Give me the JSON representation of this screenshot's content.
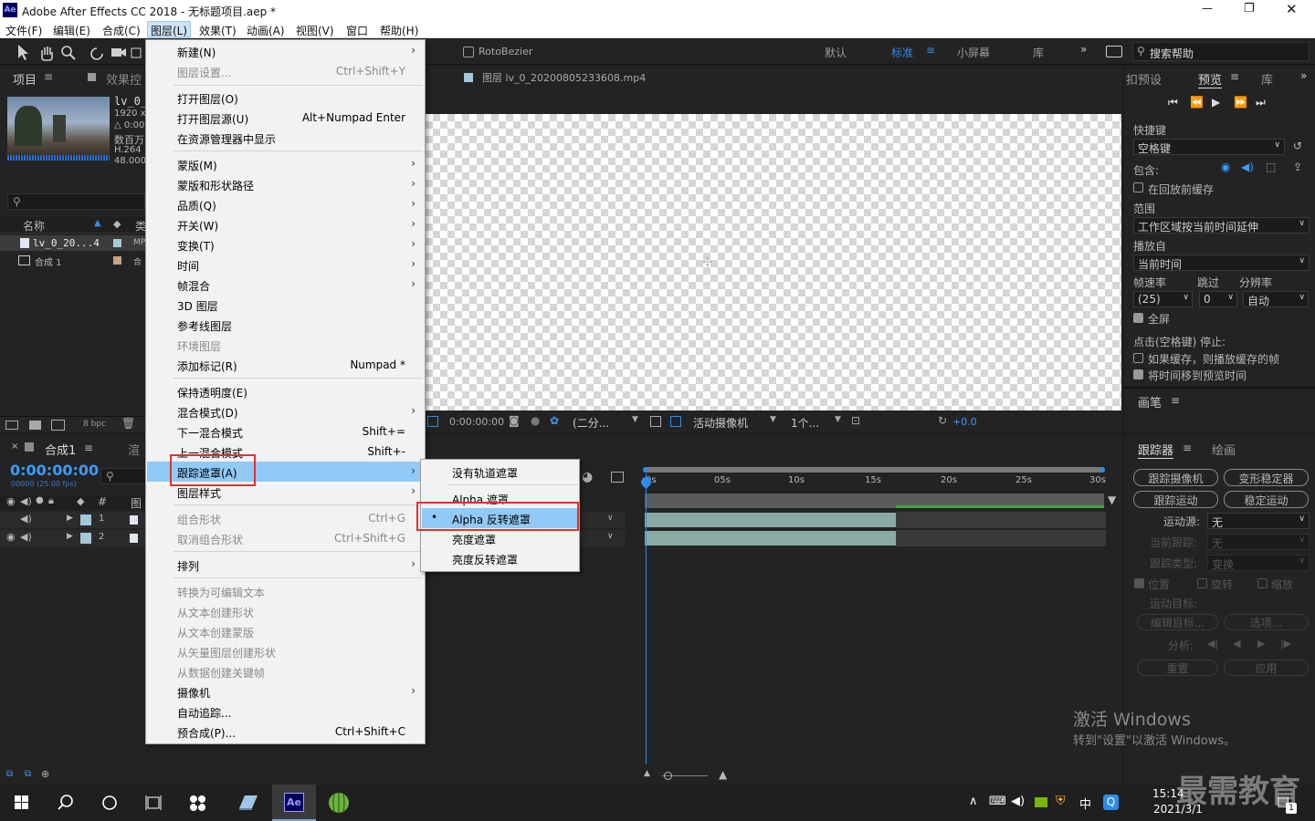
{
  "titlebar": {
    "title": "Adobe After Effects CC 2018 - 无标题项目.aep *",
    "logo": "Ae",
    "min": "—",
    "max": "❐",
    "close": "✕"
  },
  "menubar": [
    "文件(F)",
    "编辑(E)",
    "合成(C)",
    "图层(L)",
    "效果(T)",
    "动画(A)",
    "视图(V)",
    "窗口",
    "帮助(H)"
  ],
  "toolbar": {
    "rotobezier": "RotoBezier",
    "workspaces": [
      "默认",
      "标准",
      "小屏幕",
      "库"
    ],
    "search": "搜索帮助"
  },
  "project": {
    "tab1": "项目",
    "tab2": "效果控",
    "file_name": "lv_0_",
    "file_info": [
      "1920 x 1",
      "△ 0:00:",
      "数百万",
      "H.264",
      "48.000"
    ],
    "col_name": "名称",
    "col_type": "类",
    "rows": [
      {
        "name": "lv_0_20...4",
        "type": "MP"
      },
      {
        "name": "合成 1",
        "type": "合"
      }
    ],
    "bpc": "8 bpc"
  },
  "viewer": {
    "tab": "图层 lv_0_20200805233608.mp4",
    "timecode": "0:00:00:00",
    "res": "(二分...",
    "camera": "活动摄像机",
    "views": "1个...",
    "exposure": "+0.0"
  },
  "preview": {
    "tab1": "扣预设",
    "tab2": "预览",
    "tab3": "库",
    "shortcut_label": "快捷键",
    "shortcut_val": "空格键",
    "include_label": "包含:",
    "cache_label": "在回放前缓存",
    "range_label": "范围",
    "range_val": "工作区域按当前时间延伸",
    "play_from_label": "播放自",
    "play_from_val": "当前时间",
    "fps_label": "帧速率",
    "skip_label": "跳过",
    "res_label": "分辨率",
    "fps_val": "(25)",
    "skip_val": "0",
    "res_val": "自动",
    "fullscreen": "全屏",
    "stop_label": "点击(空格键) 停止:",
    "stop_opt1": "如果缓存，则播放缓存的帧",
    "stop_opt2": "将时间移到预览时间",
    "brush_tab": "画笔"
  },
  "tracker": {
    "tab1": "跟踪器",
    "tab2": "绘画",
    "btns": [
      "跟踪摄像机",
      "变形稳定器",
      "跟踪运动",
      "稳定运动"
    ],
    "source_label": "运动源:",
    "source_val": "无",
    "current_label": "当前跟踪:",
    "current_val": "无",
    "type_label": "跟踪类型:",
    "type_val": "变换",
    "pos": "位置",
    "rot": "旋转",
    "scale": "缩放",
    "target_label": "运动目标:",
    "edit_target": "编辑目标...",
    "options": "选项...",
    "analyze": "分析:",
    "reset": "重置",
    "apply": "应用"
  },
  "timeline": {
    "tab": "合成1",
    "render_tab": "渲",
    "timecode": "0:00:00:00",
    "subtime": "00000 (25.00 fps)",
    "col_num": "#",
    "col_src": "图",
    "layers": [
      "1",
      "2"
    ],
    "ruler": [
      "0s",
      "05s",
      "10s",
      "15s",
      "20s",
      "25s",
      "30s"
    ]
  },
  "layer_menu": [
    {
      "label": "新建(N)",
      "arrow": true
    },
    {
      "label": "图层设置...",
      "shortcut": "Ctrl+Shift+Y",
      "disabled": true
    },
    {
      "label": "打开图层(O)"
    },
    {
      "label": "打开图层源(U)",
      "shortcut": "Alt+Numpad Enter"
    },
    {
      "label": "在资源管理器中显示"
    },
    {
      "label": "蒙版(M)",
      "arrow": true
    },
    {
      "label": "蒙版和形状路径",
      "arrow": true
    },
    {
      "label": "品质(Q)",
      "arrow": true
    },
    {
      "label": "开关(W)",
      "arrow": true
    },
    {
      "label": "变换(T)",
      "arrow": true
    },
    {
      "label": "时间",
      "arrow": true
    },
    {
      "label": "帧混合",
      "arrow": true
    },
    {
      "label": "3D 图层"
    },
    {
      "label": "参考线图层"
    },
    {
      "label": "环境图层",
      "disabled": true
    },
    {
      "label": "添加标记(R)",
      "shortcut": "Numpad *"
    },
    {
      "label": "保持透明度(E)"
    },
    {
      "label": "混合模式(D)",
      "arrow": true
    },
    {
      "label": "下一混合模式",
      "shortcut": "Shift+="
    },
    {
      "label": "上一混合模式",
      "shortcut": "Shift+-"
    },
    {
      "label": "跟踪遮罩(A)",
      "arrow": true,
      "highlighted": true
    },
    {
      "label": "图层样式",
      "arrow": true
    },
    {
      "label": "组合形状",
      "shortcut": "Ctrl+G",
      "disabled": true
    },
    {
      "label": "取消组合形状",
      "shortcut": "Ctrl+Shift+G",
      "disabled": true
    },
    {
      "label": "排列",
      "arrow": true
    },
    {
      "label": "转换为可编辑文本",
      "disabled": true
    },
    {
      "label": "从文本创建形状",
      "disabled": true
    },
    {
      "label": "从文本创建蒙版",
      "disabled": true
    },
    {
      "label": "从矢量图层创建形状",
      "disabled": true
    },
    {
      "label": "从数据创建关键帧",
      "disabled": true
    },
    {
      "label": "摄像机",
      "arrow": true
    },
    {
      "label": "自动追踪..."
    },
    {
      "label": "预合成(P)...",
      "shortcut": "Ctrl+Shift+C"
    }
  ],
  "track_matte_menu": [
    {
      "label": "没有轨道遮罩"
    },
    {
      "label": "Alpha 遮罩"
    },
    {
      "label": "Alpha 反转遮罩",
      "selected": true
    },
    {
      "label": "亮度遮罩"
    },
    {
      "label": "亮度反转遮罩"
    }
  ],
  "watermark": {
    "line1": "激活 Windows",
    "line2": "转到\"设置\"以激活 Windows。",
    "brand": "最需教育"
  },
  "taskbar": {
    "time": "15:14",
    "date": "2021/3/1",
    "ime": "中",
    "notif": "1"
  }
}
